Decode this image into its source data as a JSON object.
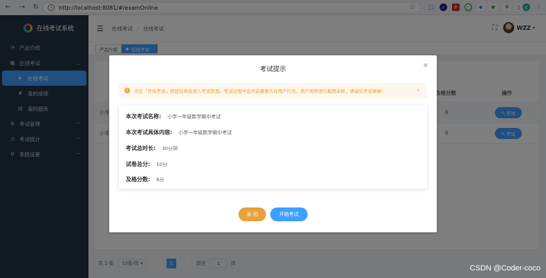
{
  "browser": {
    "url": "http://localhost:8081/#/examOnline"
  },
  "sidebar": {
    "title": "在线考试系统",
    "items": [
      {
        "label": "产品介绍",
        "icon": "dashboard-icon"
      },
      {
        "label": "在线考试",
        "icon": "grid-icon"
      },
      {
        "label": "在线考试",
        "icon": "send-icon",
        "sub": true,
        "active": true
      },
      {
        "label": "我的成绩",
        "icon": "trophy-icon",
        "sub": true
      },
      {
        "label": "我的题库",
        "icon": "book-icon",
        "sub": true
      },
      {
        "label": "考试管理",
        "icon": "gear-icon"
      },
      {
        "label": "考试统计",
        "icon": "chart-icon"
      },
      {
        "label": "系统设置",
        "icon": "settings-icon"
      }
    ]
  },
  "header": {
    "breadcrumb_home": "在线考试",
    "breadcrumb_sep": "/",
    "breadcrumb_current": "在线考试",
    "user_name": "WZZ"
  },
  "tags": {
    "tag1": "产品介绍",
    "tag2": "在线考试"
  },
  "table": {
    "col_pass": "及格分数",
    "col_op": "操作",
    "rows": [
      {
        "name": "小学",
        "pass": "6",
        "op": "考试"
      },
      {
        "name": "小学",
        "pass": "6",
        "op": "考试"
      }
    ]
  },
  "pager": {
    "total": "共 2 条",
    "size": "10条/页",
    "page": "1",
    "goto": "前往",
    "goto_value": "1",
    "unit": "页"
  },
  "dialog": {
    "title": "考试提示",
    "alert": "点击「开始考试」按钮后将会进入考试页面。考试过程中会开启摄像头对用户行为、用户视频进行截图采样，请诚信考试谢谢!",
    "fields": [
      {
        "label": "本次考试名称:",
        "value": "小学一年级数学期中考试"
      },
      {
        "label": "本次考试具体内容:",
        "value": "小学一年级数学期中考试"
      },
      {
        "label": "考试总时长:",
        "value": "30分钟"
      },
      {
        "label": "试卷总分:",
        "value": "10分"
      },
      {
        "label": "及格分数:",
        "value": "6分"
      }
    ],
    "back_label": "返 回",
    "start_label": "开始考试"
  },
  "watermark": "CSDN @Coder-coco"
}
